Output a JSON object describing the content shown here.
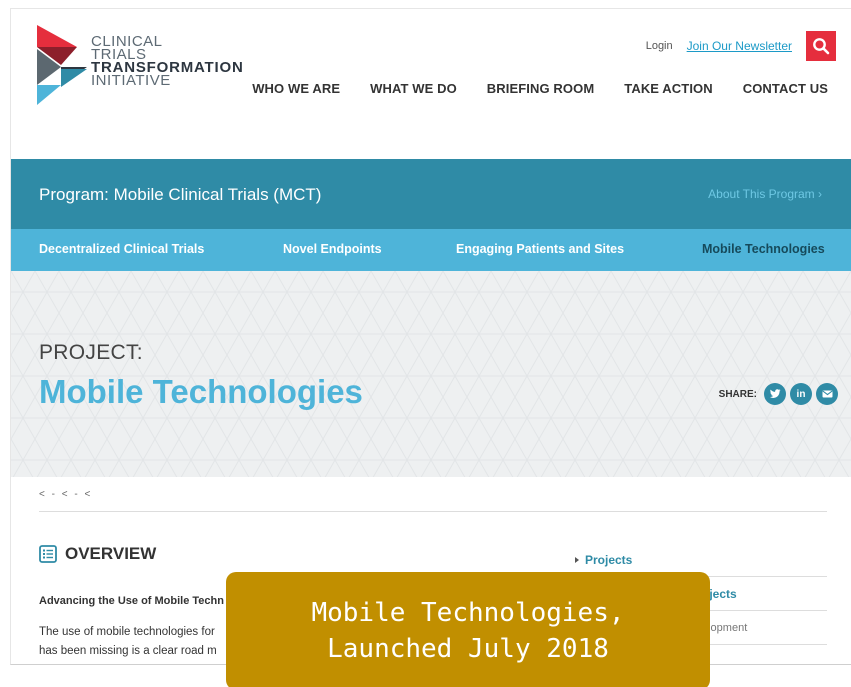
{
  "header": {
    "logo": {
      "line1": "CLINICAL",
      "line2": "TRIALS",
      "line3": "TRANSFORMATION",
      "line4": "INITIATIVE"
    },
    "utility": {
      "login": "Login",
      "newsletter": "Join Our Newsletter"
    },
    "nav": [
      "WHO WE ARE",
      "WHAT WE DO",
      "BRIEFING ROOM",
      "TAKE ACTION",
      "CONTACT US"
    ]
  },
  "program": {
    "title": "Program: Mobile Clinical Trials (MCT)",
    "about": "About This Program  ›"
  },
  "subnav": {
    "items": [
      "Decentralized Clinical Trials",
      "Novel Endpoints",
      "Engaging Patients and Sites",
      "Mobile Technologies"
    ],
    "active_index": 3
  },
  "hero": {
    "kicker": "PROJECT:",
    "title": "Mobile Technologies",
    "share_label": "SHARE:",
    "share_icons": [
      "twitter-icon",
      "linkedin-icon",
      "email-icon"
    ]
  },
  "breadcrumb": "< - < - <",
  "overview": {
    "heading": "OVERVIEW",
    "lead": "Advancing the Use of Mobile Techn",
    "body_line1": "The use of mobile technologies for",
    "body_line2": "has been missing is a clear road m"
  },
  "side": {
    "items": [
      "Projects",
      "ojects",
      "elopment"
    ]
  },
  "caption": {
    "line1": "Mobile Technologies,",
    "line2": "Launched July 2018"
  },
  "colors": {
    "brand_red": "#e52e3d",
    "program_bar": "#2f8ba6",
    "subnav_bar": "#4eb4d9",
    "caption_bg": "#c18f00"
  }
}
